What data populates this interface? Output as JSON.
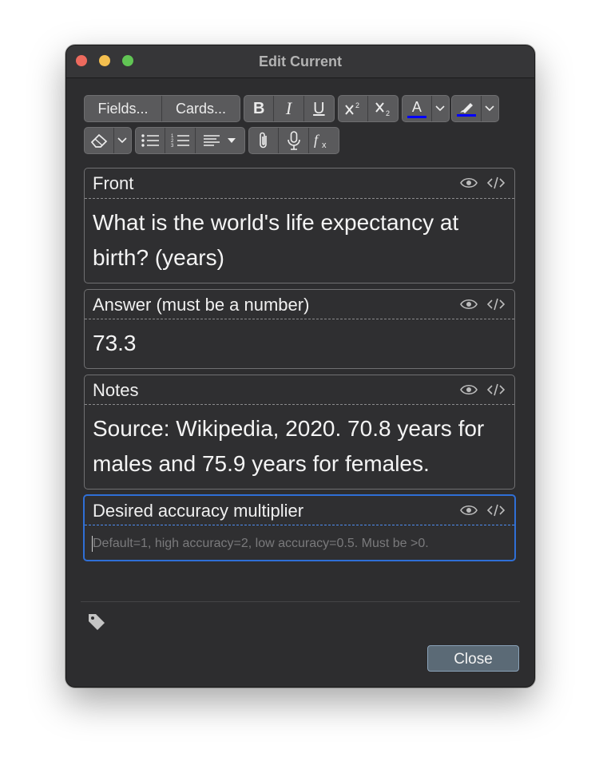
{
  "window": {
    "title": "Edit Current"
  },
  "toolbar": {
    "fields_label": "Fields...",
    "cards_label": "Cards...",
    "bold_label": "B",
    "italic_label": "I",
    "underline_label": "U",
    "text_color_label": "A",
    "icons": [
      "bold-icon",
      "italic-icon",
      "underline-icon",
      "superscript-icon",
      "subscript-icon",
      "text-color-icon",
      "highlight-icon",
      "eraser-icon",
      "unordered-list-icon",
      "ordered-list-icon",
      "align-icon",
      "attach-icon",
      "microphone-icon",
      "math-formula-icon"
    ],
    "accent_color": "#0000ff"
  },
  "fields": [
    {
      "label": "Front",
      "content": "What is the world's life expectancy at birth? (years)"
    },
    {
      "label": "Answer (must be a number)",
      "content": "73.3"
    },
    {
      "label": "Notes",
      "content": "Source: Wikipedia, 2020. 70.8 years for males and 75.9 years for females."
    },
    {
      "label": "Desired accuracy multiplier",
      "content": "",
      "placeholder": "Default=1, high accuracy=2, low accuracy=0.5. Must be >0."
    }
  ],
  "footer": {
    "close_label": "Close"
  },
  "colors": {
    "focus": "#2f6fd6",
    "background": "#2d2d2f"
  }
}
